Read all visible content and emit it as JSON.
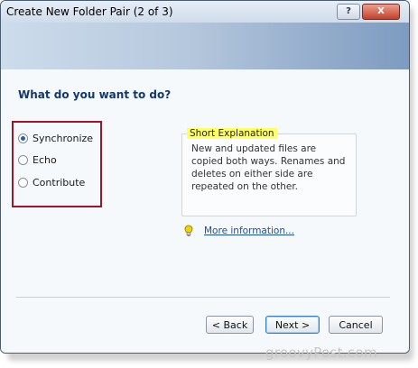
{
  "window": {
    "title": "Create New Folder Pair (2 of 3)",
    "help_label": "?",
    "close_label": "X"
  },
  "prompt": {
    "heading": "What do you want to do?"
  },
  "options": [
    {
      "label": "Synchronize",
      "selected": true
    },
    {
      "label": "Echo",
      "selected": false
    },
    {
      "label": "Contribute",
      "selected": false
    }
  ],
  "explanation": {
    "title": "Short Explanation",
    "text": "New and updated files are copied both ways. Renames and deletes on either side are repeated on the other."
  },
  "more_info": {
    "label": "More information..."
  },
  "buttons": {
    "back": "< Back",
    "next": "Next >",
    "cancel": "Cancel"
  },
  "watermark": "groovyPost.com",
  "colors": {
    "heading": "#13386e",
    "highlight": "#ffff66",
    "annotation_border": "#a0142a",
    "link": "#1b4f9c"
  }
}
